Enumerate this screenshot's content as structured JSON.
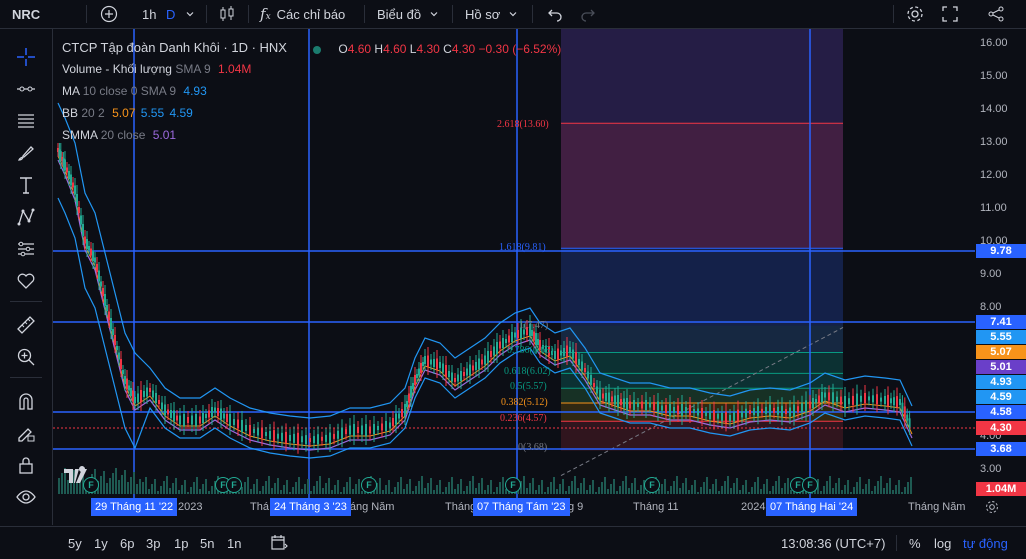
{
  "symbol": "NRC",
  "toolbar": {
    "interval": "1h",
    "interval_d": "D",
    "indicators_label": "Các chỉ báo",
    "chart_type_label": "Biểu đồ",
    "profile_label": "Hồ sơ"
  },
  "legend": {
    "title": "CTCP Tập đoàn Danh Khôi · 1D · HNX",
    "o_label": "O",
    "o": "4.60",
    "h_label": "H",
    "h": "4.60",
    "l_label": "L",
    "l": "4.30",
    "c_label": "C",
    "c": "4.30",
    "change": "−0.30 (−6.52%)",
    "volume": "Volume - Khối lượng",
    "volume_params": "SMA 9",
    "volume_value": "1.04M",
    "ma": "MA",
    "ma_params": "10 close 0 SMA 9",
    "ma_value": "4.93",
    "bb": "BB",
    "bb_params": "20 2",
    "bb_v1": "5.07",
    "bb_v2": "5.55",
    "bb_v3": "4.59",
    "smma": "SMMA",
    "smma_params": "20 close",
    "smma_value": "5.01"
  },
  "price_axis": [
    "16.00",
    "15.00",
    "14.00",
    "13.00",
    "12.00",
    "11.00",
    "10.00",
    "9.00",
    "8.00",
    "4.00",
    "3.00"
  ],
  "price_badges": [
    {
      "text": "9.78",
      "color": "#2962ff"
    },
    {
      "text": "7.41",
      "color": "#2962ff"
    },
    {
      "text": "5.55",
      "color": "#2196f3"
    },
    {
      "text": "5.07",
      "color": "#f7931a"
    },
    {
      "text": "5.01",
      "color": "#6a3fc9"
    },
    {
      "text": "4.93",
      "color": "#2196f3"
    },
    {
      "text": "4.59",
      "color": "#2196f3"
    },
    {
      "text": "4.58",
      "color": "#2962ff"
    },
    {
      "text": "4.30",
      "color": "#f23645"
    },
    {
      "text": "3.68",
      "color": "#2962ff"
    },
    {
      "text": "1.04M",
      "color": "#f23645"
    }
  ],
  "fib_levels": [
    {
      "label": "2.618(13.60)",
      "color": "#f23645"
    },
    {
      "label": "1.618(9.81)",
      "color": "#2962ff"
    },
    {
      "label": "1(7.47)",
      "color": "#787b86"
    },
    {
      "label": "0.786(6.65)",
      "color": "#089981"
    },
    {
      "label": "0.618(6.02)",
      "color": "#089981"
    },
    {
      "label": "0.5(5.57)",
      "color": "#089981"
    },
    {
      "label": "0.382(5.12)",
      "color": "#f7931a"
    },
    {
      "label": "0.236(4.57)",
      "color": "#f23645"
    },
    {
      "label": "0(3.68)",
      "color": "#787b86"
    }
  ],
  "time_axis": {
    "highlights": [
      "29 Tháng 11 '22",
      "24 Tháng 3 '23",
      "07 Tháng Tám '23",
      "07 Tháng Hai '24"
    ],
    "months": [
      "2023",
      "Thá",
      "Tháng Năm",
      "Tháng",
      "g 9",
      "Tháng 11",
      "2024",
      "Tháng Năm"
    ]
  },
  "event_marker": "F",
  "bottom": {
    "ranges": [
      "5y",
      "1y",
      "6p",
      "3p",
      "1p",
      "5n",
      "1n"
    ],
    "time": "13:08:36 (UTC+7)",
    "percent": "%",
    "log": "log",
    "auto": "tự động"
  }
}
